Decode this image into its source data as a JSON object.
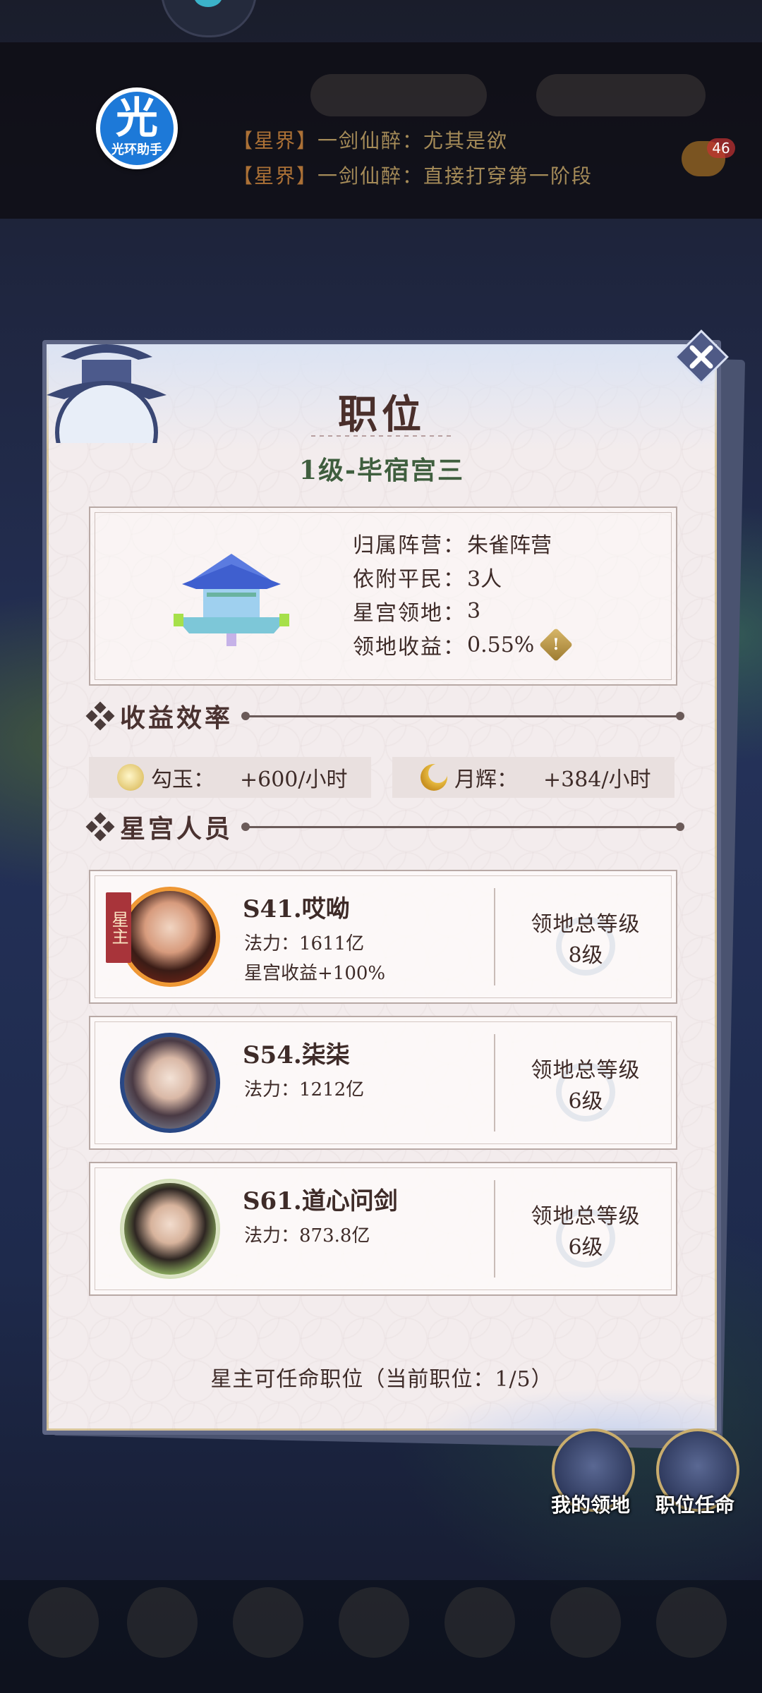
{
  "top": {
    "news": [
      {
        "tag": "【星界】",
        "text": "一剑仙醉：尤其是欲"
      },
      {
        "tag": "【星界】",
        "text": "一剑仙醉：直接打穿第一阶段"
      }
    ],
    "chat_badge": "46"
  },
  "overlay_app": {
    "glyph": "光",
    "label": "光环助手"
  },
  "dialog": {
    "title": "职位",
    "subtitle": "1级-毕宿宫三",
    "info": [
      {
        "key": "归属阵营：",
        "value": "朱雀阵营"
      },
      {
        "key": "依附平民：",
        "value": "3人"
      },
      {
        "key": "星宫领地：",
        "value": "3"
      },
      {
        "key": "领地收益：",
        "value": "0.55%"
      }
    ],
    "yield_section": "收益效率",
    "yields": [
      {
        "icon": "jade-icon",
        "label": "勾玉：",
        "value": "+600/小时"
      },
      {
        "icon": "moon-icon",
        "label": "月辉：",
        "value": "+384/小时"
      }
    ],
    "members_section": "星宫人员",
    "members": [
      {
        "owner_tag": "星主",
        "name": "S41.哎呦",
        "power": "法力：1611亿",
        "bonus": "星宫收益+100%",
        "level_label": "领地总等级",
        "level": "8级"
      },
      {
        "name": "S54.柒柒",
        "power": "法力：1212亿",
        "level_label": "领地总等级",
        "level": "6级"
      },
      {
        "name": "S61.道心问剑",
        "power": "法力：873.8亿",
        "level_label": "领地总等级",
        "level": "6级"
      }
    ],
    "footer_note": "星主可任命职位（当前职位：1/5）"
  },
  "side_buttons": [
    {
      "label": "我的领地"
    },
    {
      "label": "职位任命"
    }
  ],
  "colors": {
    "owner_tag": "#a8343a",
    "dialog_bg": "#f3eced",
    "frame": "#5d6584",
    "subtitle": "#3f5e3e"
  }
}
